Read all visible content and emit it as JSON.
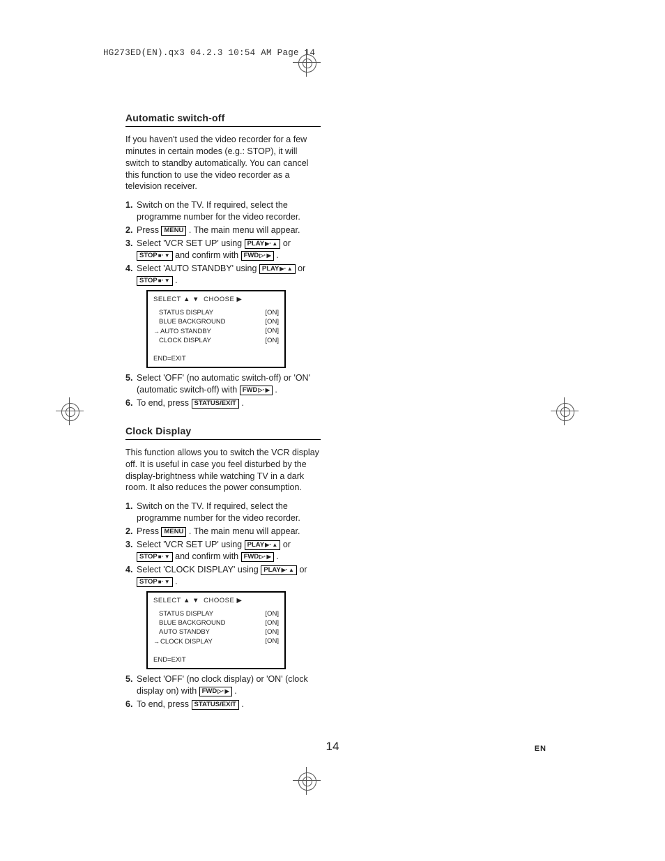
{
  "header": "HG273ED(EN).qx3  04.2.3  10:54 AM  Page 14",
  "page_number": "14",
  "lang_tag": "EN",
  "buttons": {
    "menu": "MENU",
    "play_up": "PLAY",
    "stop_down": "STOP",
    "fwd_right": "FWD",
    "status_exit": "STATUS/EXIT"
  },
  "osd_common": {
    "header_select": "SELECT",
    "header_choose": "CHOOSE",
    "end": "END=EXIT",
    "on": "[ON]"
  },
  "section1": {
    "title": "Automatic switch-off",
    "intro": "If you haven't used the video recorder for a few minutes in certain modes (e.g.: STOP), it will switch to standby automatically. You can cancel this function to use the video recorder as a television receiver.",
    "steps": {
      "s1": "Switch on the TV. If required, select the programme number for the video recorder.",
      "s2a": "Press ",
      "s2b": ". The main menu will appear.",
      "s3a": "Select 'VCR SET UP' using ",
      "s3b": " or ",
      "s3c": " and confirm with ",
      "s3d": ".",
      "s4a": "Select 'AUTO STANDBY' using ",
      "s4b": " or ",
      "s4c": ".",
      "s5a": "Select 'OFF' (no automatic switch-off) or 'ON' (automatic switch-off) with ",
      "s5b": ".",
      "s6a": "To end, press ",
      "s6b": "."
    },
    "osd": {
      "rows": [
        {
          "label": "STATUS DISPLAY",
          "pointer": false
        },
        {
          "label": "BLUE BACKGROUND",
          "pointer": false
        },
        {
          "label": "AUTO STANDBY",
          "pointer": true
        },
        {
          "label": "CLOCK DISPLAY",
          "pointer": false
        }
      ]
    }
  },
  "section2": {
    "title": "Clock Display",
    "intro": "This function allows you to switch the VCR display off.  It is useful in case you feel disturbed by the display-brightness while watching TV in a dark room.  It also reduces the power consumption.",
    "steps": {
      "s1": "Switch on the TV. If required, select the programme number for the video recorder.",
      "s2a": "Press ",
      "s2b": ". The main menu will appear.",
      "s3a": "Select 'VCR SET UP' using ",
      "s3b": " or ",
      "s3c": " and confirm with ",
      "s3d": ".",
      "s4a": "Select 'CLOCK DISPLAY' using ",
      "s4b": " or ",
      "s4c": ".",
      "s5a": "Select 'OFF' (no clock display) or 'ON' (clock display on) with ",
      "s5b": ".",
      "s6a": "To end, press ",
      "s6b": "."
    },
    "osd": {
      "rows": [
        {
          "label": "STATUS DISPLAY",
          "pointer": false
        },
        {
          "label": "BLUE BACKGROUND",
          "pointer": false
        },
        {
          "label": "AUTO STANDBY",
          "pointer": false
        },
        {
          "label": "CLOCK DISPLAY",
          "pointer": true
        }
      ]
    }
  }
}
